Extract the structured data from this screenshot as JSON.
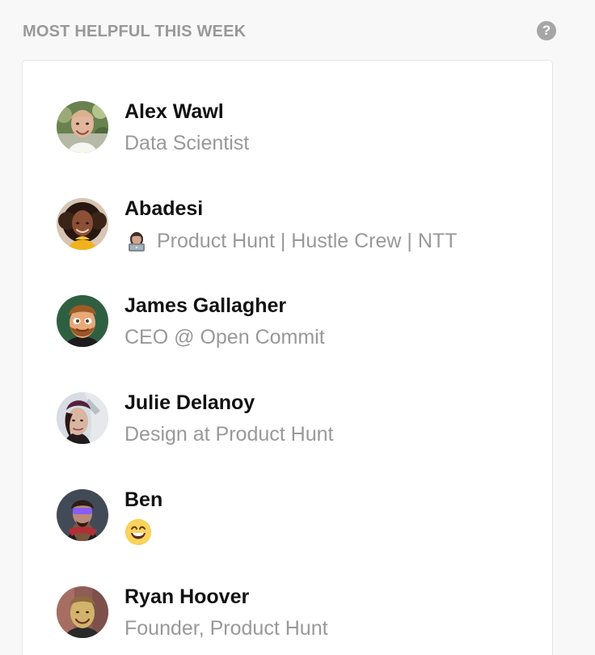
{
  "section": {
    "title": "MOST HELPFUL THIS WEEK",
    "help_icon": "question-circle-icon",
    "help_glyph": "?"
  },
  "users": [
    {
      "name": "Alex Wawl",
      "headline": "Data Scientist",
      "avatar_icon": "avatar-alex-wawl"
    },
    {
      "name": "Abadesi",
      "headline": "Product Hunt | Hustle Crew | NTT",
      "headline_icon": "woman-technologist-emoji",
      "avatar_icon": "avatar-abadesi"
    },
    {
      "name": "James Gallagher",
      "headline": "CEO @ Open Commit",
      "avatar_icon": "avatar-james-gallagher"
    },
    {
      "name": "Julie Delanoy",
      "headline": "Design at Product Hunt",
      "avatar_icon": "avatar-julie-delanoy"
    },
    {
      "name": "Ben",
      "headline_icon": "grinning-face-emoji",
      "avatar_icon": "avatar-ben"
    },
    {
      "name": "Ryan Hoover",
      "headline": "Founder, Product Hunt",
      "avatar_icon": "avatar-ryan-hoover"
    }
  ],
  "colors": {
    "page_background": "#f8f8f8",
    "card_background": "#ffffff",
    "section_title": "#999999",
    "name_text": "#111111",
    "headline_text": "#999999",
    "help_icon": "#a6a6a6",
    "card_border": "#e6e6e6"
  }
}
